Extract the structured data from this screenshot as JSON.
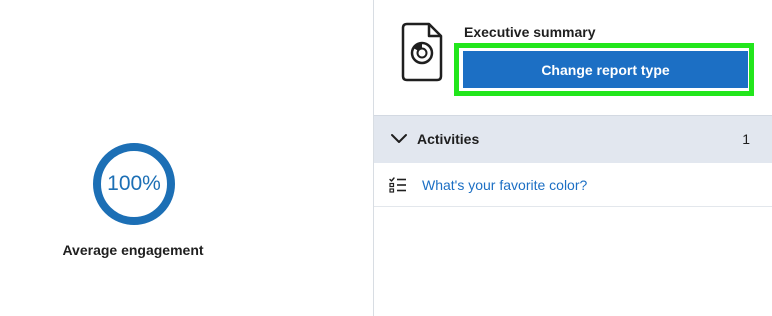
{
  "engagement": {
    "percent_label": "100%",
    "percent_value": 100,
    "label": "Average engagement"
  },
  "report": {
    "title": "Executive summary",
    "change_button_label": "Change report type",
    "icon": "document-chart-icon"
  },
  "activities": {
    "label": "Activities",
    "count": "1",
    "items": [
      {
        "label": "What's your favorite color?",
        "icon": "checklist-icon"
      }
    ]
  },
  "colors": {
    "accent": "#1c6fc4",
    "ring": "#1c6fb5",
    "focus_outline": "#22e61c",
    "section_bar": "#e2e7ef"
  }
}
